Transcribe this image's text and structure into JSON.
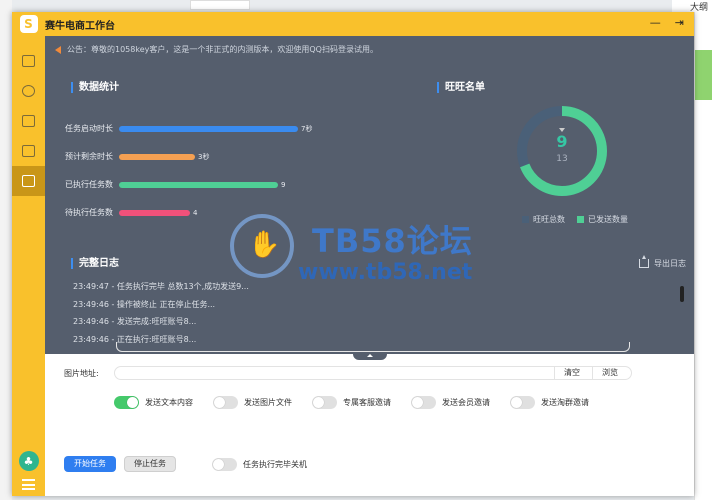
{
  "background": {
    "top_right_text": "大纲"
  },
  "window": {
    "title": "赛牛电商工作台",
    "minimize_glyph": "—",
    "close_glyph": "⇥"
  },
  "sidebar": {
    "icons": [
      "image-icon",
      "clock-icon",
      "calendar-icon",
      "export-icon",
      "screen-icon"
    ]
  },
  "notice": "公告：尊敬的1058key客户，这是一个非正式的内测版本，欢迎使用QQ扫码登录试用。",
  "stats": {
    "title": "数据统计",
    "rows": [
      {
        "label": "任务启动时长",
        "value": "7秒",
        "fraction": 0.78,
        "color": "#3a8bef"
      },
      {
        "label": "预计剩余时长",
        "value": "3秒",
        "fraction": 0.33,
        "color": "#f5a052"
      },
      {
        "label": "已执行任务数",
        "value": "9",
        "fraction": 0.69,
        "color": "#4fcf95"
      },
      {
        "label": "待执行任务数",
        "value": "4",
        "fraction": 0.31,
        "color": "#f0517a"
      }
    ]
  },
  "wangwang": {
    "title": "旺旺名单",
    "sent": "9",
    "total": "13",
    "sent_fraction": 0.69,
    "legend_total": "旺旺总数",
    "legend_sent": "已发送数量",
    "color_total": "#4a6078",
    "color_sent": "#4fcf95"
  },
  "log": {
    "title": "完整日志",
    "export_label": "导出日志",
    "lines": [
      "23:49:47 - 任务执行完毕 总数13个,成功发送9...",
      "23:49:46 - 操作被终止 正在停止任务...",
      "23:49:46 - 发送完成:旺旺账号8...",
      "23:49:46 - 正在执行:旺旺账号8..."
    ]
  },
  "watermark": {
    "big": "TB58论坛",
    "url": "www.tb58.net"
  },
  "image_field": {
    "label": "图片地址:",
    "value": "",
    "clear_label": "清空",
    "browse_label": "浏览"
  },
  "toggles": [
    {
      "label": "发送文本内容",
      "on": true
    },
    {
      "label": "发送图片文件",
      "on": false
    },
    {
      "label": "专属客服邀请",
      "on": false
    },
    {
      "label": "发送会员邀请",
      "on": false
    },
    {
      "label": "发送淘群邀请",
      "on": false
    }
  ],
  "actions": {
    "start_label": "开始任务",
    "stop_label": "停止任务",
    "shutdown_label": "任务执行完毕关机",
    "shutdown_on": false
  }
}
